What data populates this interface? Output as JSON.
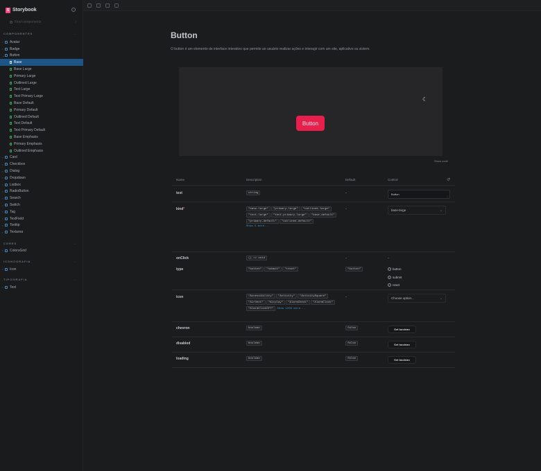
{
  "sidebar": {
    "brand": "Storybook",
    "search_placeholder": "Find components",
    "search_shortcut": "/",
    "groups": [
      {
        "label": "COMPONENTES",
        "items_before": [
          "Avatar",
          "Badge"
        ],
        "open": "Button",
        "stories": [
          "Base",
          "Base Large",
          "Primary Large",
          "Outlined Large",
          "Text Large",
          "Text Primary Large",
          "Base Default",
          "Primary Default",
          "Outlined Default",
          "Text Default",
          "Text Primary Default",
          "Base Emphasis",
          "Primary Emphasis",
          "Outlined Emphasis"
        ],
        "items_after": [
          "Card",
          "Checkbox",
          "Dialog",
          "Dropdown",
          "Listbox",
          "RadioButton",
          "Search",
          "Switch",
          "Tag",
          "TextField",
          "Tooltip",
          "Textarea"
        ]
      },
      {
        "label": "CORES",
        "items": [
          "ColorsGrid"
        ]
      },
      {
        "label": "ICONOGRAFIA",
        "items": [
          "Icon"
        ]
      },
      {
        "label": "TIPOGRAFIA",
        "items": [
          "Text"
        ]
      }
    ],
    "active_story": "Base"
  },
  "docs": {
    "title": "Button",
    "description": "O button é um elemento de interface interativo que permite ao usuário realizar ações e interagir com um site, aplicativo ou sistem.",
    "demo_button_label": "Button",
    "show_code": "Show code"
  },
  "args_table": {
    "headers": {
      "name": "Name",
      "description": "Description",
      "default": "Default",
      "control": "Control"
    },
    "rows": {
      "text": {
        "name": "text",
        "types": [
          "string"
        ],
        "default": "-",
        "control_value": "Button"
      },
      "kind": {
        "name": "kind",
        "required": "*",
        "types": [
          "\"base-large\"",
          "\"primary-large\"",
          "\"outlined-large\"",
          "\"text-large\"",
          "\"text-primary-large\"",
          "\"base-default\"",
          "\"primary-default\"",
          "\"outlined-default\""
        ],
        "more": "Show 5 more...",
        "default": "-",
        "control_value": "base-large"
      },
      "onClick": {
        "name": "onClick",
        "types": [
          "() => void"
        ],
        "default": "-",
        "control_value": "-"
      },
      "type": {
        "name": "type",
        "types": [
          "\"button\"",
          "\"submit\"",
          "\"reset\""
        ],
        "default": "\"button\"",
        "options": [
          "button",
          "submit",
          "reset"
        ]
      },
      "icon": {
        "name": "icon",
        "types": [
          "\"Accessibility\"",
          "\"Activity\"",
          "\"ActivitySquare\"",
          "\"AirVent\"",
          "\"Airplay\"",
          "\"AlarmCheck\"",
          "\"AlarmClock\"",
          "\"AlarmClockOff\""
        ],
        "more": "Show 1250 more...",
        "default": "-",
        "control_value": "Choose option..."
      },
      "chevron": {
        "name": "chevron",
        "types": [
          "boolean"
        ],
        "default": "false",
        "control_value": "Set boolean"
      },
      "disabled": {
        "name": "disabled",
        "types": [
          "boolean"
        ],
        "default": "false",
        "control_value": "Set boolean"
      },
      "loading": {
        "name": "loading",
        "types": [
          "boolean"
        ],
        "default": "false",
        "control_value": "Set boolean"
      }
    }
  },
  "colors": {
    "accent": "#ff4785",
    "selection": "#1e5587",
    "demo_button": "#e81e4c",
    "link": "#3c97d6"
  }
}
